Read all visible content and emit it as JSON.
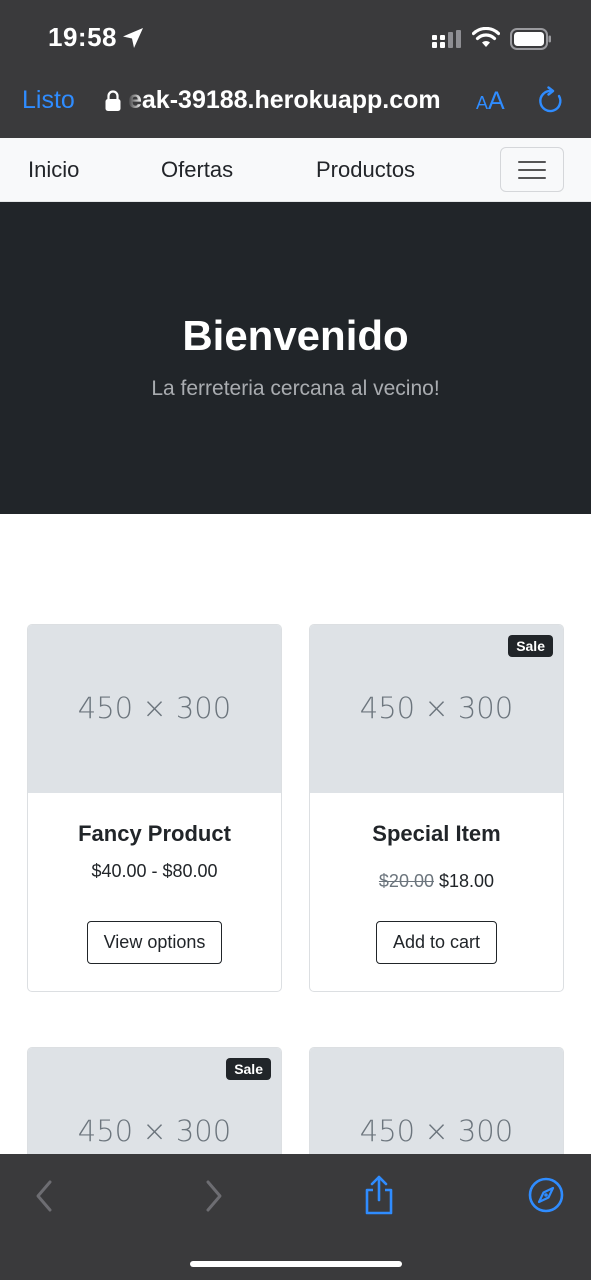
{
  "status_bar": {
    "time": "19:58",
    "icons": [
      "location-arrow-icon",
      "cellular-signal-icon",
      "wifi-icon",
      "battery-icon"
    ]
  },
  "safari": {
    "done_label": "Listo",
    "url": "eak-39188.herokuapp.com",
    "text_size_label_small": "A",
    "text_size_label_big": "A",
    "icons": [
      "lock-icon",
      "reload-icon"
    ],
    "accent": "#2f8cff"
  },
  "navbar": {
    "links": [
      "Inicio",
      "Ofertas",
      "Productos"
    ],
    "toggler_icon": "hamburger-menu-icon"
  },
  "hero": {
    "title": "Bienvenido",
    "subtitle": "La ferreteria cercana al vecino!"
  },
  "products": [
    {
      "image_label": "450 × 300",
      "name": "Fancy Product",
      "price": "$40.00 - $80.00",
      "button": "View options",
      "badge": ""
    },
    {
      "image_label": "450 × 300",
      "name": "Special Item",
      "old_price": "$20.00",
      "price": "$18.00",
      "button": "Add to cart",
      "badge": "Sale"
    },
    {
      "image_label": "450 × 300",
      "badge": "Sale"
    },
    {
      "image_label": "450 × 300",
      "badge": ""
    }
  ],
  "toolbar": {
    "icons": [
      "back-icon",
      "forward-icon",
      "share-icon",
      "compass-icon"
    ]
  },
  "colors": {
    "hero_bg": "#212529",
    "safari_chrome": "#3a3a3c",
    "navbar_bg": "#f8f9fa",
    "image_placeholder": "#dee2e6"
  }
}
